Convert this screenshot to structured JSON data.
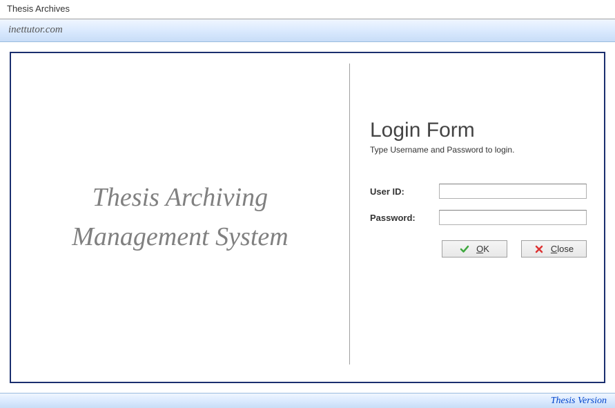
{
  "window": {
    "title": "Thesis Archives"
  },
  "menubar": {
    "text": "inettutor.com"
  },
  "left": {
    "app_name_line1": "Thesis Archiving",
    "app_name_line2": "Management System"
  },
  "login": {
    "title": "Login Form",
    "subtitle": "Type Username and Password to login.",
    "user_label": "User ID:",
    "password_label": "Password:",
    "user_value": "",
    "password_value": ""
  },
  "buttons": {
    "ok": "OK",
    "close": "Close"
  },
  "statusbar": {
    "version": "Thesis Version"
  }
}
